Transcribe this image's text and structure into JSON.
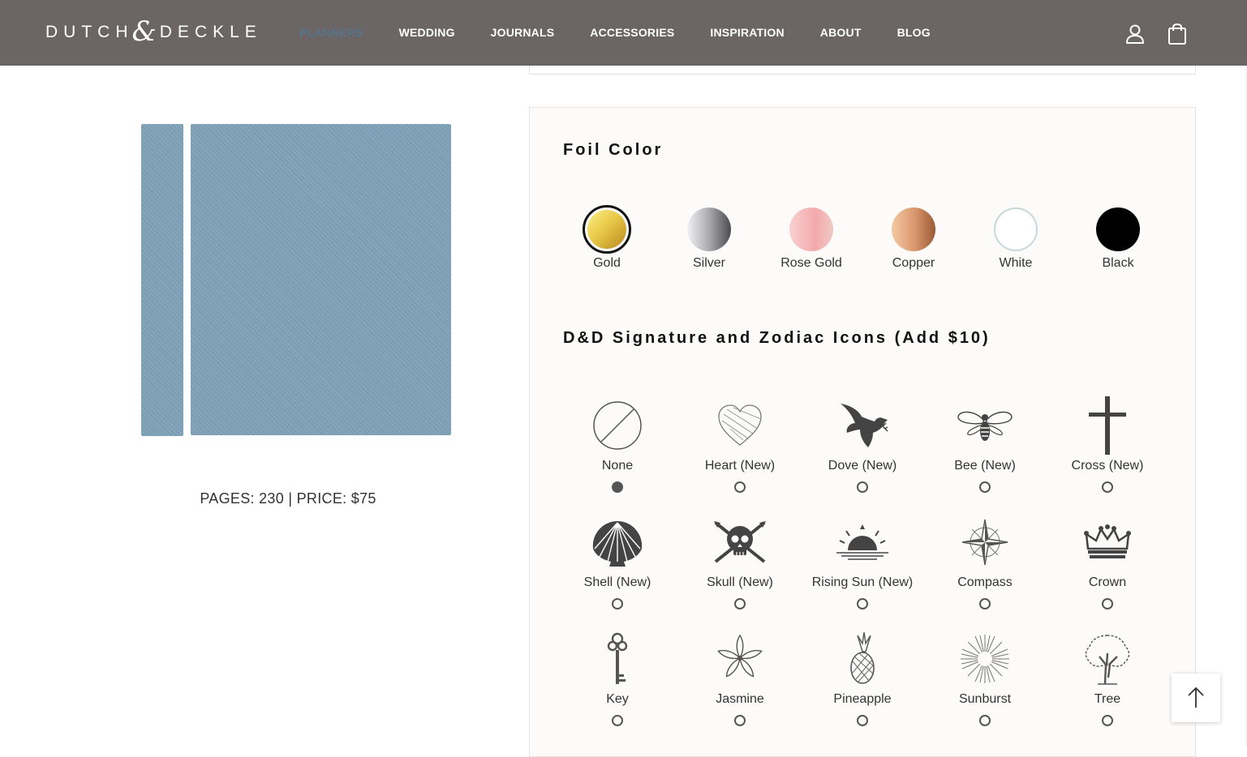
{
  "header": {
    "logo_left": "DUTCH",
    "logo_amp": "&",
    "logo_right": "DECKLE",
    "nav": [
      {
        "label": "PLANNERS"
      },
      {
        "label": "WEDDING"
      },
      {
        "label": "JOURNALS"
      },
      {
        "label": "ACCESSORIES"
      },
      {
        "label": "INSPIRATION"
      },
      {
        "label": "ABOUT"
      },
      {
        "label": "BLOG"
      }
    ],
    "icons": [
      "user-icon",
      "shopping-bag-icon"
    ]
  },
  "product": {
    "color": "#7fa1b8",
    "info": "PAGES: 230 | PRICE: $75"
  },
  "foil": {
    "title": "Foil Color",
    "options": [
      {
        "label": "Gold",
        "color": "#d8b53a",
        "selected": true
      },
      {
        "label": "Silver",
        "color": "#a8a8ad",
        "selected": false
      },
      {
        "label": "Rose Gold",
        "color": "#f2b3b3",
        "selected": false
      },
      {
        "label": "Copper",
        "color": "#d79a6e",
        "selected": false
      },
      {
        "label": "White",
        "color": "#ffffff",
        "selected": false
      },
      {
        "label": "Black",
        "color": "#000000",
        "selected": false
      }
    ]
  },
  "icons": {
    "title": "D&D Signature and Zodiac Icons (Add $10)",
    "options": [
      {
        "label": "None",
        "icon": "none-icon",
        "checked": true
      },
      {
        "label": "Heart (New)",
        "icon": "heart-icon",
        "checked": false
      },
      {
        "label": "Dove (New)",
        "icon": "dove-icon",
        "checked": false
      },
      {
        "label": "Bee (New)",
        "icon": "bee-icon",
        "checked": false
      },
      {
        "label": "Cross (New)",
        "icon": "cross-icon",
        "checked": false
      },
      {
        "label": "Shell (New)",
        "icon": "shell-icon",
        "checked": false
      },
      {
        "label": "Skull (New)",
        "icon": "skull-icon",
        "checked": false
      },
      {
        "label": "Rising Sun (New)",
        "icon": "rising-sun-icon",
        "checked": false
      },
      {
        "label": "Compass",
        "icon": "compass-icon",
        "checked": false
      },
      {
        "label": "Crown",
        "icon": "crown-icon",
        "checked": false
      },
      {
        "label": "Key",
        "icon": "key-icon",
        "checked": false
      },
      {
        "label": "Jasmine",
        "icon": "jasmine-icon",
        "checked": false
      },
      {
        "label": "Pineapple",
        "icon": "pineapple-icon",
        "checked": false
      },
      {
        "label": "Sunburst",
        "icon": "sunburst-icon",
        "checked": false
      },
      {
        "label": "Tree",
        "icon": "tree-icon",
        "checked": false
      }
    ]
  },
  "back_to_top": {
    "icon": "arrow-up-icon"
  }
}
